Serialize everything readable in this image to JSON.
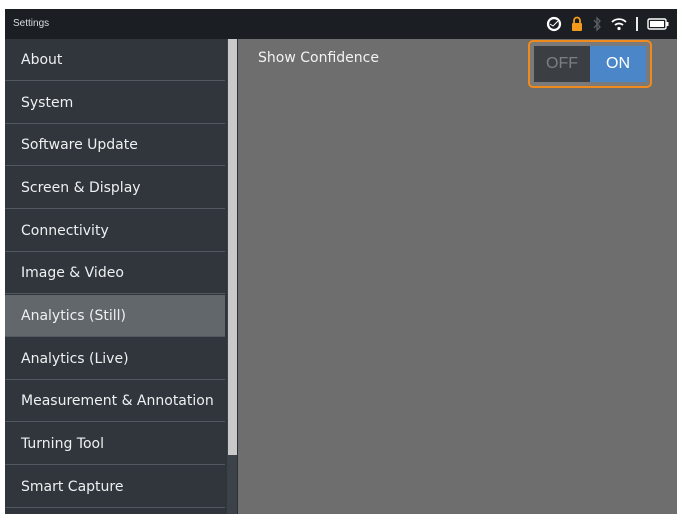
{
  "statusbar": {
    "title": "Settings",
    "icons": [
      "sync-icon",
      "lock-icon",
      "bluetooth-icon",
      "wifi-icon",
      "battery-icon"
    ]
  },
  "sidebar": {
    "items": [
      {
        "label": "About"
      },
      {
        "label": "System"
      },
      {
        "label": "Software Update"
      },
      {
        "label": "Screen & Display"
      },
      {
        "label": "Connectivity"
      },
      {
        "label": "Image & Video"
      },
      {
        "label": "Analytics (Still)",
        "selected": true
      },
      {
        "label": "Analytics (Live)"
      },
      {
        "label": "Measurement & Annotation"
      },
      {
        "label": "Turning Tool"
      },
      {
        "label": "Smart Capture"
      }
    ]
  },
  "content": {
    "show_confidence": {
      "label": "Show Confidence",
      "off_label": "OFF",
      "on_label": "ON",
      "value": "ON"
    }
  },
  "colors": {
    "accent": "#f08a1c",
    "toggle_on": "#4a86c8",
    "selected_item": "#62676c"
  }
}
